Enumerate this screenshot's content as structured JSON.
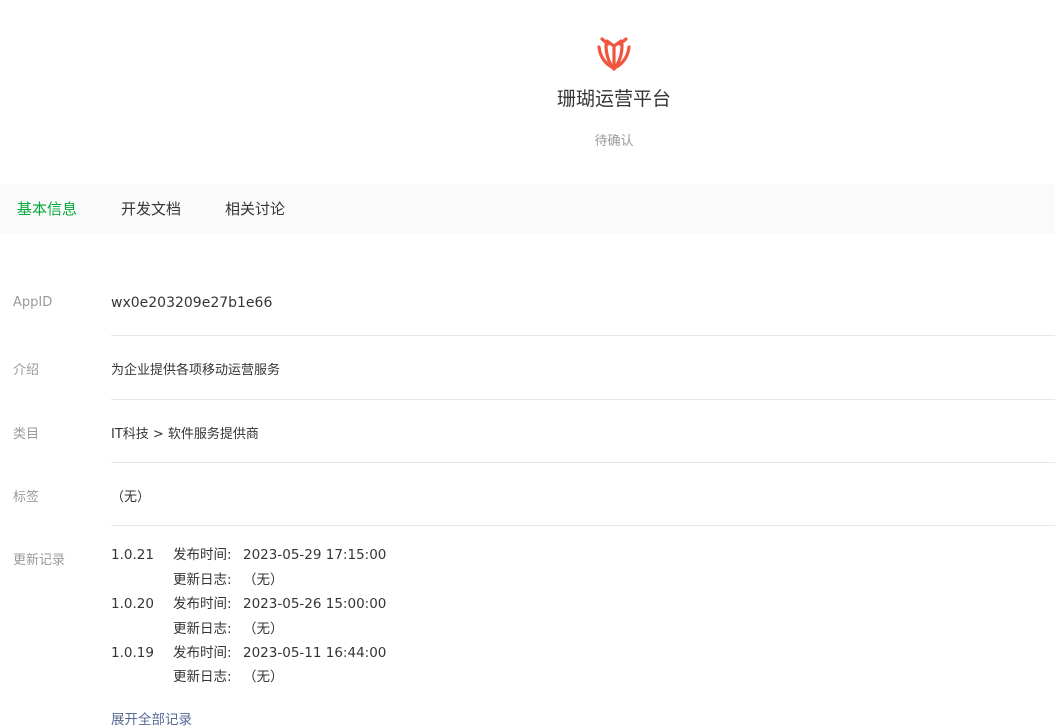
{
  "app": {
    "name": "珊瑚运营平台",
    "status": "待确认",
    "logo_icon": "coral-logo-icon",
    "logo_color": "#f0563f"
  },
  "tabs": [
    {
      "label": "基本信息",
      "active": true
    },
    {
      "label": "开发文档",
      "active": false
    },
    {
      "label": "相关讨论",
      "active": false
    }
  ],
  "info": {
    "appid_label": "AppID",
    "appid_value": "wx0e203209e27b1e66",
    "intro_label": "介绍",
    "intro_value": "为企业提供各项移动运营服务",
    "category_label": "类目",
    "category_value": "IT科技 > 软件服务提供商",
    "tags_label": "标签",
    "tags_value": "（无）",
    "updates_label": "更新记录"
  },
  "updates": [
    {
      "version": "1.0.21",
      "time_label": "发布时间:",
      "time": "2023-05-29 17:15:00",
      "log_label": "更新日志:",
      "log": "（无）"
    },
    {
      "version": "1.0.20",
      "time_label": "发布时间:",
      "time": "2023-05-26 15:00:00",
      "log_label": "更新日志:",
      "log": "（无）"
    },
    {
      "version": "1.0.19",
      "time_label": "发布时间:",
      "time": "2023-05-11 16:44:00",
      "log_label": "更新日志:",
      "log": "（无）"
    }
  ],
  "expand_link": "展开全部记录",
  "colors": {
    "accent_green": "#07a83d",
    "link_blue": "#576b95"
  }
}
